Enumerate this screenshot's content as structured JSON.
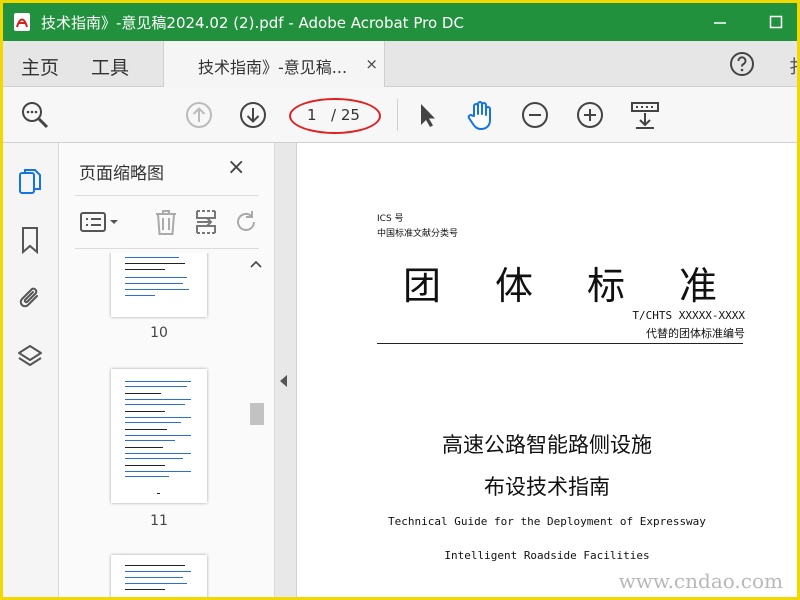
{
  "colors": {
    "titlebar": "#21913d",
    "accent_blue": "#1473e6",
    "annotation_red": "#e02020",
    "frame": "#f0d800"
  },
  "window": {
    "title": "技术指南》-意见稿2024.02 (2).pdf - Adobe Acrobat Pro DC"
  },
  "tabs": {
    "home": "主页",
    "tools": "工具",
    "document": "技术指南》-意见稿...",
    "document_close": "×",
    "edge_char": "扌"
  },
  "toolbar": {
    "current_page": "1",
    "total_pages": "/ 25"
  },
  "panel": {
    "title": "页面缩略图",
    "close": "×",
    "thumbnails": [
      {
        "number": "10"
      },
      {
        "number": "11"
      }
    ]
  },
  "document": {
    "ics": "ICS 号",
    "classification": "中国标准文献分类号",
    "big_title": [
      "团",
      "体",
      "标",
      "准"
    ],
    "standard_code": "T/CHTS XXXXX-XXXX",
    "replaces": "代替的团体标准编号",
    "title_line1": "高速公路智能路侧设施",
    "title_line2": "布设技术指南",
    "english_line1": "Technical Guide for the Deployment of Expressway",
    "english_line2": "Intelligent Roadside Facilities"
  },
  "watermark": "www.cndao.com"
}
